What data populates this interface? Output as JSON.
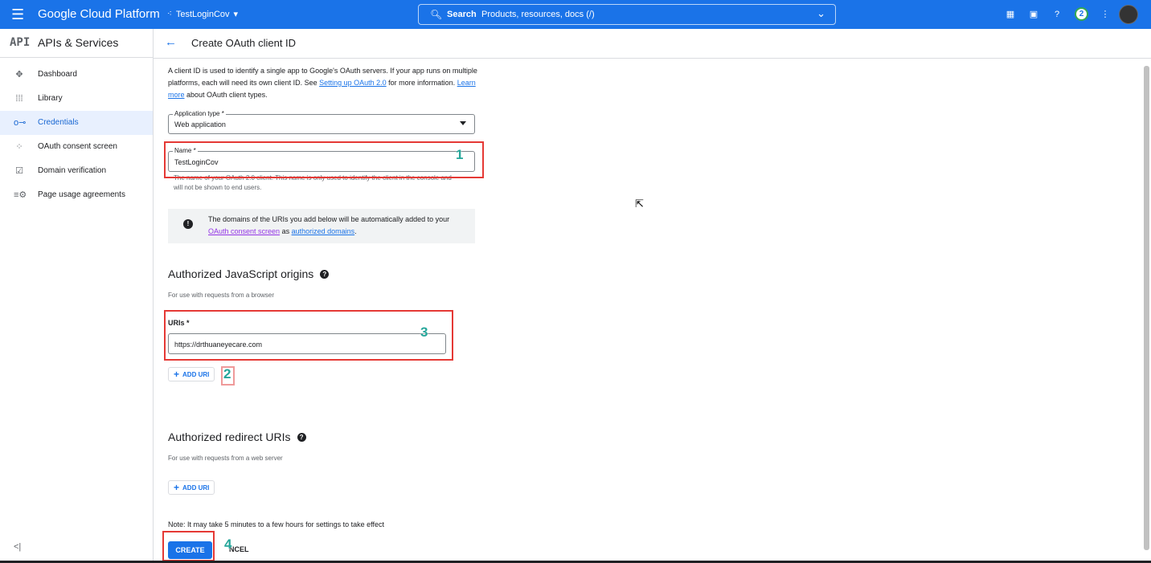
{
  "topbar": {
    "brand": "Google Cloud Platform",
    "project": "TestLoginCov",
    "search_label": "Search",
    "search_placeholder": "Products, resources, docs (/)",
    "notification_count": "2",
    "icons": [
      "menu-icon",
      "project-dots-icon",
      "search-icon",
      "chevron-down-icon",
      "gift-icon",
      "terminal-icon",
      "help-icon",
      "more-vert-icon"
    ]
  },
  "sidebar": {
    "logo": "API",
    "title": "APIs & Services",
    "items": [
      {
        "label": "Dashboard",
        "icon": "✥"
      },
      {
        "label": "Library",
        "icon": "⁞⁞⁞"
      },
      {
        "label": "Credentials",
        "icon": "o⊸"
      },
      {
        "label": "OAuth consent screen",
        "icon": "⁘"
      },
      {
        "label": "Domain verification",
        "icon": "☑"
      },
      {
        "label": "Page usage agreements",
        "icon": "≡⚙"
      }
    ],
    "collapse_label": "<|"
  },
  "header": {
    "title": "Create OAuth client ID"
  },
  "intro": {
    "text_before_link1": "A client ID is used to identify a single app to Google's OAuth servers. If your app runs on multiple platforms, each will need its own client ID. See ",
    "link1": "Setting up OAuth 2.0",
    "text_between": " for more information. ",
    "link2": "Learn more",
    "text_after": " about OAuth client types."
  },
  "form": {
    "app_type_label": "Application type *",
    "app_type_value": "Web application",
    "name_label": "Name *",
    "name_value": "TestLoginCov",
    "name_hint": "The name of your OAuth 2.0 client. This name is only used to identify the client in the console and will not be shown to end users."
  },
  "info": {
    "text_before": "The domains of the URIs you add below will be automatically added to your ",
    "link1": "OAuth consent screen",
    "text_mid": " as ",
    "link2": "authorized domains",
    "text_after": "."
  },
  "js_origins": {
    "title": "Authorized JavaScript origins",
    "subtitle": "For use with requests from a browser",
    "uri_label": "URIs *",
    "uri_value": "https://drthuaneyecare.com",
    "add_label": "ADD URI"
  },
  "redirects": {
    "title": "Authorized redirect URIs",
    "subtitle": "For use with requests from a web server",
    "add_label": "ADD URI"
  },
  "footer": {
    "note": "Note: It may take 5 minutes to a few hours for settings to take effect",
    "create_label": "CREATE",
    "cancel_label": "NCEL"
  },
  "annotations": [
    "1",
    "2",
    "3",
    "4"
  ],
  "colors": {
    "primary": "#1a73e8",
    "annotation_box": "#e53935",
    "annotation_number": "#26a69a"
  }
}
